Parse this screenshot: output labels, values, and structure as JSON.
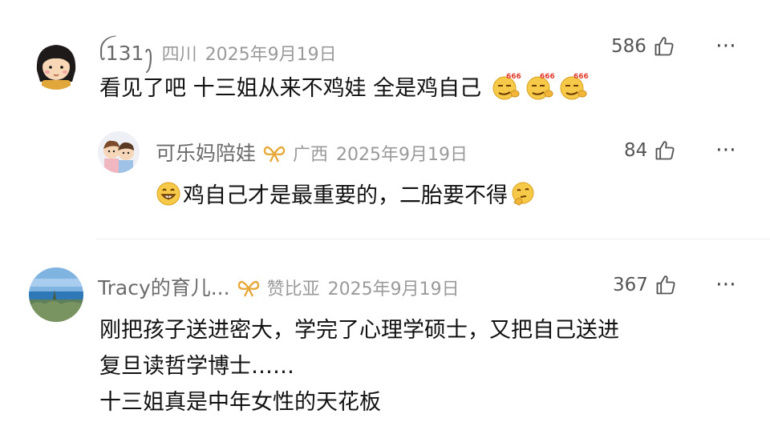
{
  "comments": [
    {
      "username": "ꪶ131ꫂ",
      "location": "四川",
      "date": "2025年9月19日",
      "likes": "586",
      "text": "看见了吧 十三姐从来不鸡娃 全是鸡自己",
      "emojis": [
        "666-smug-emoji",
        "666-smug-emoji",
        "666-smug-emoji"
      ],
      "emoji_label": "666",
      "reply": {
        "username": "可乐妈陪娃",
        "location": "广西",
        "date": "2025年9月19日",
        "likes": "84",
        "text": "鸡自己才是最重要的，二胎要不得",
        "lead_emoji": "grin-emoji",
        "trail_emoji": "thinking-emoji"
      }
    },
    {
      "username": "Tracy的育儿...",
      "location": "赞比亚",
      "date": "2025年9月19日",
      "likes": "367",
      "lines": [
        "刚把孩子送进密大，学完了心理学硕士，又把自己送进",
        "复旦读哲学博士……",
        "十三姐真是中年女性的天花板"
      ]
    }
  ],
  "icons": {
    "like": "thumbs-up-icon",
    "more": "more-dots-icon",
    "badge": "gold-bow-badge-icon"
  },
  "colors": {
    "name": "#6b6b6b",
    "meta": "#9a9a9a",
    "text": "#111111",
    "badge": "#e6a93a"
  }
}
